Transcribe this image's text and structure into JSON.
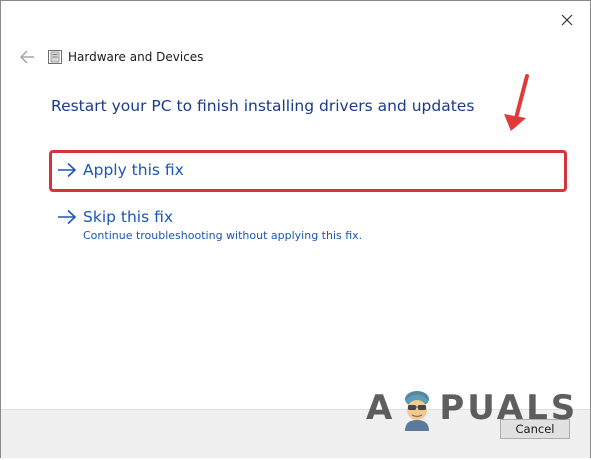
{
  "window": {
    "title": "Hardware and Devices",
    "close_icon": "close-icon",
    "back_icon": "back-arrow-icon",
    "app_icon": "troubleshooter-icon"
  },
  "main": {
    "heading": "Restart your PC to finish installing drivers and updates",
    "options": [
      {
        "label": "Apply this fix",
        "icon": "arrow-right-icon"
      },
      {
        "label": "Skip this fix",
        "description": "Continue troubleshooting without applying this fix.",
        "icon": "arrow-right-icon"
      }
    ]
  },
  "footer": {
    "cancel_label": "Cancel"
  },
  "annotation": {
    "highlight_color": "#d8323a"
  },
  "watermark": {
    "prefix": "A",
    "suffix": "PUALS"
  },
  "colors": {
    "heading": "#1a3a8c",
    "link": "#1a56b8",
    "footer_bg": "#f0f0f0"
  }
}
